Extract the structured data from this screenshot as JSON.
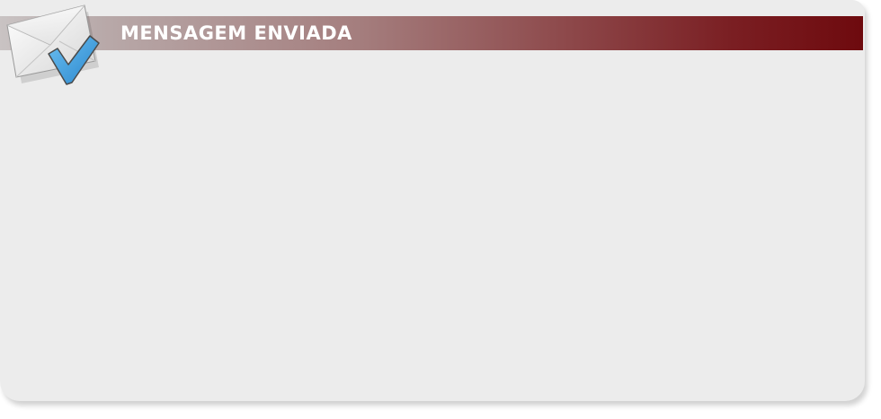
{
  "dialog": {
    "title": "MENSAGEM ENVIADA",
    "icon": "envelope-check-icon"
  },
  "colors": {
    "panel_background": "#ececec",
    "banner_start": "#c9c3c3",
    "banner_end": "#6e0a0e",
    "title_text": "#ffffff",
    "check_blue": "#3a9de0"
  }
}
